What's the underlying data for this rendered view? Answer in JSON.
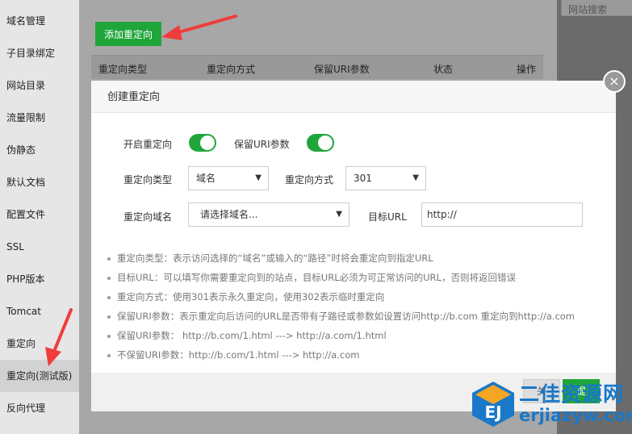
{
  "sidebar": {
    "items": [
      {
        "label": "域名管理"
      },
      {
        "label": "子目录绑定"
      },
      {
        "label": "网站目录"
      },
      {
        "label": "流量限制"
      },
      {
        "label": "伪静态"
      },
      {
        "label": "默认文档"
      },
      {
        "label": "配置文件"
      },
      {
        "label": "SSL"
      },
      {
        "label": "PHP版本"
      },
      {
        "label": "Tomcat"
      },
      {
        "label": "重定向"
      },
      {
        "label": "重定向(测试版)"
      },
      {
        "label": "反向代理"
      }
    ],
    "active_index": 11
  },
  "background": {
    "add_button": "添加重定向",
    "columns": [
      "重定向类型",
      "重定向方式",
      "保留URI参数",
      "状态",
      "操作"
    ],
    "search_placeholder": "网站搜索"
  },
  "modal": {
    "title": "创建重定向",
    "close_symbol": "×",
    "fields": {
      "enable_label": "开启重定向",
      "enable_on": true,
      "keep_uri_label": "保留URI参数",
      "keep_uri_on": true,
      "type_label": "重定向类型",
      "type_value": "域名",
      "method_label": "重定向方式",
      "method_value": "301",
      "domain_label": "重定向域名",
      "domain_placeholder": "请选择域名...",
      "target_label": "目标URL",
      "target_value": "http://"
    },
    "tips": [
      "重定向类型：表示访问选择的“域名”或输入的“路径”时将会重定向到指定URL",
      "目标URL：可以填写你需要重定向到的站点，目标URL必须为可正常访问的URL，否则将返回错误",
      "重定向方式：使用301表示永久重定向，使用302表示临时重定向",
      "保留URI参数：表示重定向后访问的URL是否带有子路径或参数如设置访问http://b.com 重定向到http://a.com",
      "保留URI参数：  http://b.com/1.html ---> http://a.com/1.html",
      "不保留URI参数：http://b.com/1.html ---> http://a.com"
    ],
    "footer": {
      "cancel_label": "关",
      "submit_label": "提"
    }
  },
  "watermark": {
    "logo_text": "EJ",
    "title": "二佳资源网",
    "domain": "erjiazyw.com"
  },
  "colors": {
    "accent": "#20a53a",
    "arrow": "#f03c3c",
    "watermark": "#1a78c8"
  }
}
